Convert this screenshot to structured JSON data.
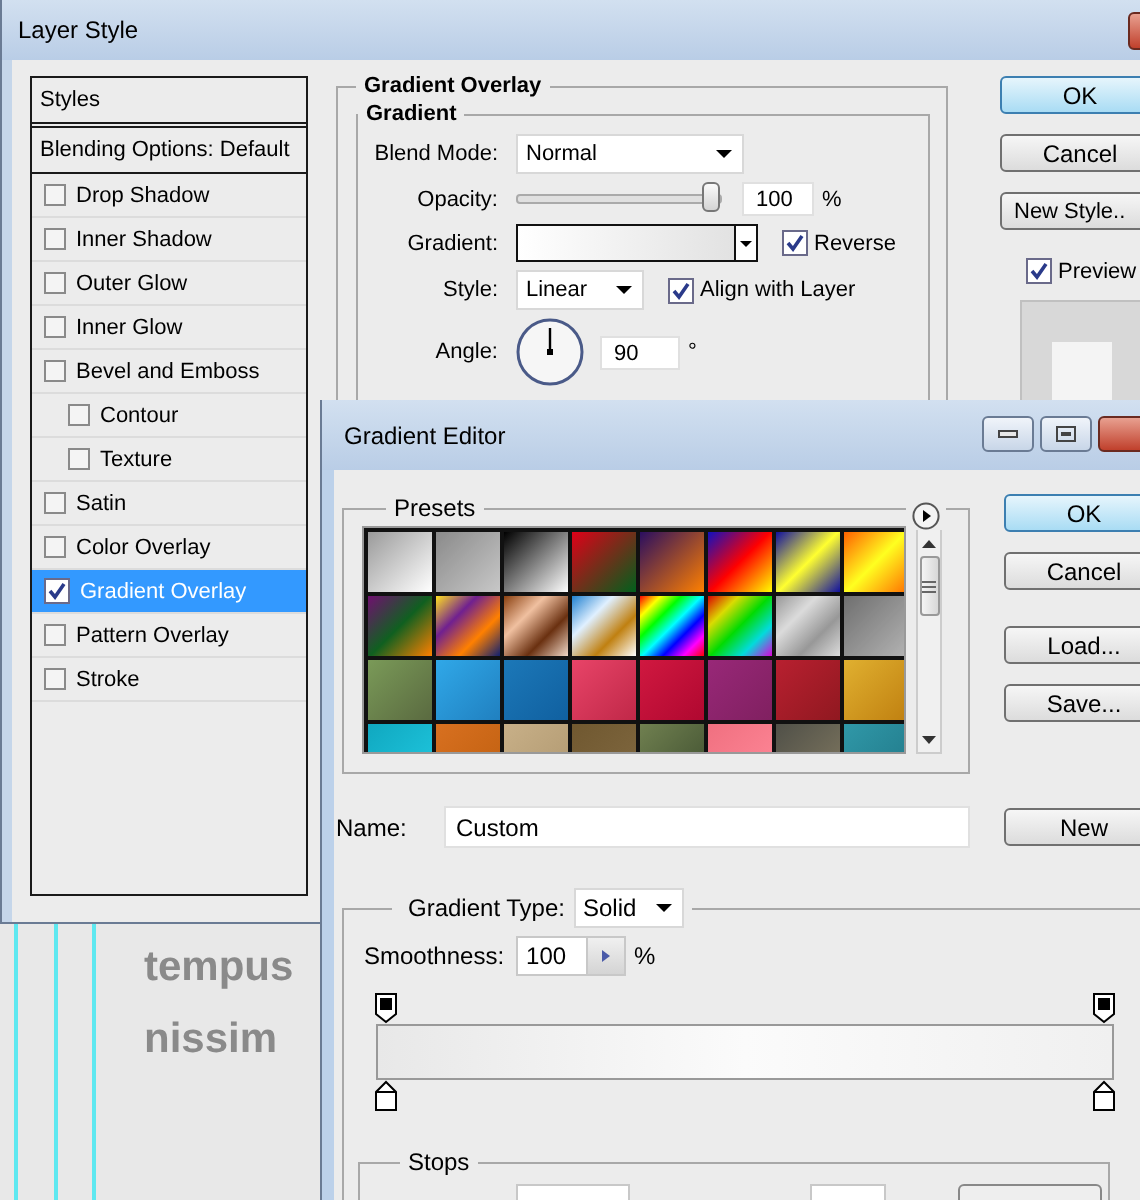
{
  "canvas": {
    "lines": [
      "tempus",
      "nissim"
    ]
  },
  "layer_style": {
    "title": "Layer Style",
    "styles_header": "Styles",
    "blending": "Blending Options: Default",
    "effects": [
      {
        "label": "Drop Shadow",
        "checked": false,
        "selected": false
      },
      {
        "label": "Inner Shadow",
        "checked": false,
        "selected": false
      },
      {
        "label": "Outer Glow",
        "checked": false,
        "selected": false
      },
      {
        "label": "Inner Glow",
        "checked": false,
        "selected": false
      },
      {
        "label": "Bevel and Emboss",
        "checked": false,
        "selected": false,
        "children": [
          {
            "label": "Contour",
            "checked": false,
            "selected": false
          },
          {
            "label": "Texture",
            "checked": false,
            "selected": false
          }
        ]
      },
      {
        "label": "Satin",
        "checked": false,
        "selected": false
      },
      {
        "label": "Color Overlay",
        "checked": false,
        "selected": false
      },
      {
        "label": "Gradient Overlay",
        "checked": true,
        "selected": true
      },
      {
        "label": "Pattern Overlay",
        "checked": false,
        "selected": false
      },
      {
        "label": "Stroke",
        "checked": false,
        "selected": false
      }
    ],
    "gradient_overlay": {
      "title": "Gradient Overlay",
      "group": "Gradient",
      "blend_mode": {
        "label": "Blend Mode:",
        "value": "Normal"
      },
      "opacity": {
        "label": "Opacity:",
        "level": 1,
        "value": "100",
        "unit": "%"
      },
      "gradient": {
        "label": "Gradient:"
      },
      "reverse": {
        "label": "Reverse",
        "checked": true
      },
      "style": {
        "label": "Style:",
        "value": "Linear"
      },
      "align": {
        "label": "Align with Layer",
        "checked": true
      },
      "angle": {
        "label": "Angle:",
        "value": "90",
        "unit": "°"
      }
    },
    "buttons": [
      {
        "label": "OK",
        "default": true
      },
      {
        "label": "Cancel",
        "default": false
      },
      {
        "label": "New Style..",
        "default": false
      }
    ],
    "preview": {
      "label": "Preview",
      "checked": true
    }
  },
  "gradient_editor": {
    "title": "Gradient Editor",
    "presets_label": "Presets",
    "buttons": [
      {
        "label": "OK",
        "default": true
      },
      {
        "label": "Cancel",
        "default": false
      },
      {
        "label": "Load...",
        "default": false
      },
      {
        "label": "Save...",
        "default": false
      }
    ],
    "name": {
      "label": "Name:",
      "value": "Custom"
    },
    "new_button": "New",
    "gradient_type": {
      "label": "Gradient Type:",
      "value": "Solid"
    },
    "smoothness": {
      "label": "Smoothness:",
      "value": "100",
      "unit": "%"
    },
    "stops_label": "Stops"
  }
}
